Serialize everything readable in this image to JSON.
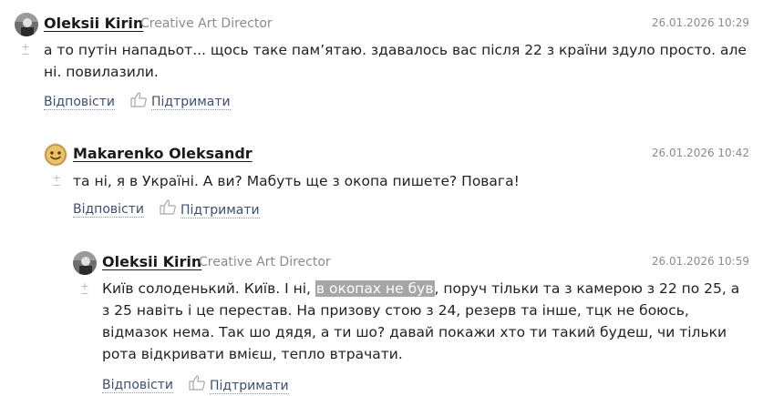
{
  "comments": [
    {
      "author": "Oleksii Kirin",
      "role": "Creative Art Director",
      "date": "26.01.2026 10:29",
      "text": "а то путін нападьот... щось таке пам’ятаю. здавалось вас після 22 з країни здуло просто. але ні. повилазили.",
      "reply": "Відповісти",
      "support": "Підтримати",
      "avatar_icon": "user-photo-icon"
    },
    {
      "author": "Makarenko Oleksandr",
      "role": "",
      "date": "26.01.2026 10:42",
      "text": "та ні, я в Україні. А ви? Мабуть ще з окопа пишете? Повага!",
      "reply": "Відповісти",
      "support": "Підтримати",
      "avatar_icon": "smiley-avatar-icon"
    },
    {
      "author": "Oleksii Kirin",
      "role": "Creative Art Director",
      "date": "26.01.2026 10:59",
      "text_before": "Київ солоденький. Київ. І ні, ",
      "text_highlight": "в окопах не був",
      "text_after": ", поруч тільки та з камерою з 22 по 25, а з 25 навіть і це перестав. На призову стою з 24, резерв та інше, тцк не боюсь, відмазок нема. Так шо дядя, а ти шо? давай покажи хто ти такий будеш, чи тільки рота відкривати вмієш, тепло втрачати.",
      "reply": "Відповісти",
      "support": "Підтримати",
      "avatar_icon": "user-photo-icon"
    }
  ],
  "icons": {
    "vote": "plus-minus-vote-icon",
    "thumb": "thumbs-up-icon"
  },
  "colors": {
    "link": "#3d4f6e",
    "muted": "#8c8c8c",
    "highlight_bg": "#a6a6a6"
  }
}
